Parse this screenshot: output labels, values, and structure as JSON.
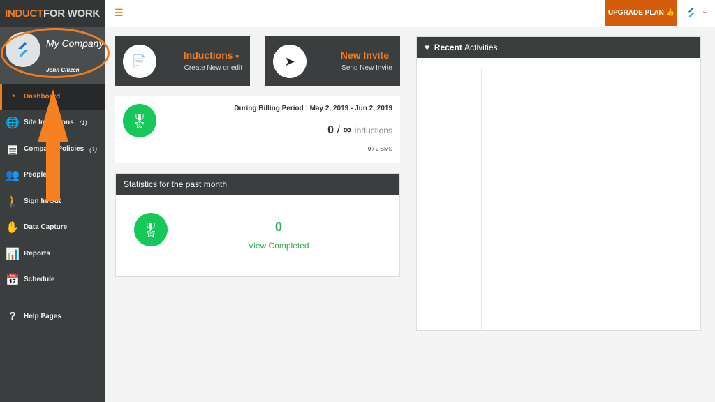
{
  "brand": {
    "part1": "INDUCT",
    "part2": "FOR WORK"
  },
  "profile": {
    "company": "My Company",
    "user": "John Citizen"
  },
  "nav": [
    {
      "label": "Dashboard",
      "icon": "dashboard-gauge-icon",
      "active": true
    },
    {
      "label": "Site Inductions",
      "icon": "globe-icon",
      "count": "(1)"
    },
    {
      "label": "Company Policies",
      "icon": "book-icon",
      "count": "(1)"
    },
    {
      "label": "People",
      "icon": "people-icon"
    },
    {
      "label": "Sign In/Out",
      "icon": "walking-icon"
    },
    {
      "label": "Data Capture",
      "icon": "hand-icon"
    },
    {
      "label": "Reports",
      "icon": "bar-chart-icon"
    },
    {
      "label": "Schedule",
      "icon": "calendar-icon"
    },
    {
      "label": "Help Pages",
      "icon": "question-icon"
    }
  ],
  "topbar": {
    "upgrade": "UPGRADE PLAN"
  },
  "inductions_card": {
    "title": "Inductions",
    "subtitle": "Create New or edit"
  },
  "invite_card": {
    "title": "New Invite",
    "subtitle": "Send New Invite"
  },
  "billing": {
    "period": "During Billing Period : May 2, 2019 - Jun 2, 2019",
    "used": "0",
    "sep": "/",
    "limit": "∞",
    "unit": "Inductions",
    "sms_used": "0",
    "sms_total": "/ 2 SMS"
  },
  "stats": {
    "title": "Statistics for the past month",
    "value": "0",
    "label": "View Completed"
  },
  "activities": {
    "title_bold": "Recent",
    "title_rest": "Activities"
  },
  "colors": {
    "accent": "#f07c1e",
    "upgrade": "#d45d0b",
    "green": "#16c75a",
    "dark": "#3b3e3f"
  }
}
